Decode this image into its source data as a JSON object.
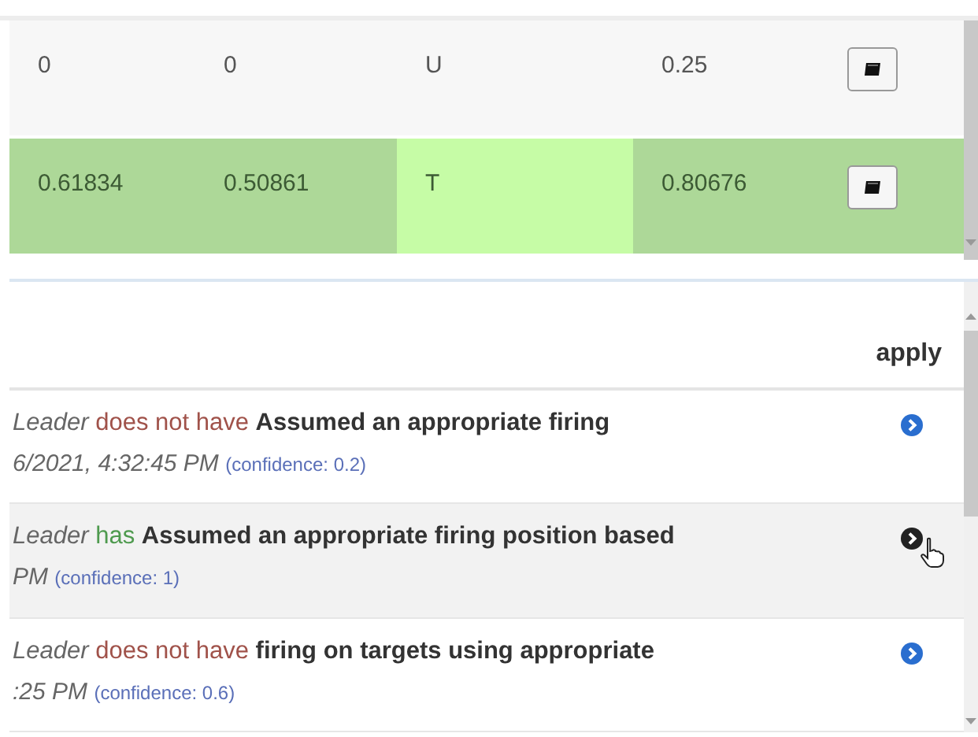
{
  "top_table": {
    "rows": [
      {
        "cells": [
          {
            "text": "0",
            "highlighted": false
          },
          {
            "text": "0",
            "highlighted": false
          },
          {
            "text": "U",
            "highlighted": false
          },
          {
            "text": "0.25",
            "highlighted": false
          }
        ],
        "matched": false
      },
      {
        "cells": [
          {
            "text": "0.61834",
            "highlighted": false
          },
          {
            "text": "0.50861",
            "highlighted": false
          },
          {
            "text": "T",
            "highlighted": true
          },
          {
            "text": "0.80676",
            "highlighted": false
          }
        ],
        "matched": true
      }
    ]
  },
  "observations": {
    "apply_header": "apply",
    "rows": [
      {
        "actor": "Leader",
        "verb": "does not have",
        "kind": "negative",
        "item": "Assumed an appropriate firing",
        "time": "6/2021, 4:32:45 PM",
        "confidence": "(confidence: 0.2)",
        "hovered": false
      },
      {
        "actor": "Leader",
        "verb": "has",
        "kind": "positive",
        "item": "Assumed an appropriate firing position based",
        "time": "PM",
        "confidence": "(confidence: 1)",
        "hovered": true
      },
      {
        "actor": "Leader",
        "verb": "does not have",
        "kind": "negative",
        "item": "firing on targets using appropriate",
        "time": ":25 PM",
        "confidence": "(confidence: 0.6)",
        "hovered": false
      }
    ]
  }
}
